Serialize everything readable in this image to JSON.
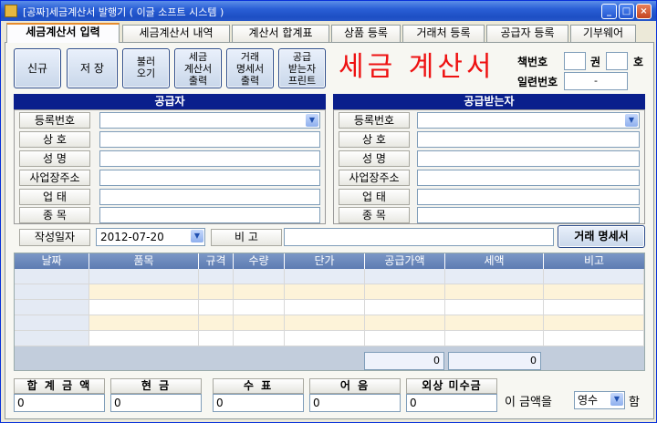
{
  "window": {
    "title": "[공짜]세금계산서 발행기 ( 이글 소프트 시스템 )",
    "min": "_",
    "max": "□",
    "close": "×"
  },
  "tabs": [
    {
      "label": "세금계산서 입력"
    },
    {
      "label": "세금계산서 내역"
    },
    {
      "label": "계산서 합계표"
    },
    {
      "label": "상품 등록"
    },
    {
      "label": "거래처 등록"
    },
    {
      "label": "공급자 등록"
    },
    {
      "label": "기부웨어"
    }
  ],
  "toolbar": {
    "new": "신규",
    "save": "저 장",
    "load": [
      "불러",
      "오기"
    ],
    "print_invoice": [
      "세금",
      "계산서",
      "출력"
    ],
    "print_statement": [
      "거래",
      "명세서",
      "출력"
    ],
    "print_receiver": [
      "공급",
      "받는자",
      "프린트"
    ]
  },
  "doc_title": "세금 계산서",
  "book": {
    "label": "책번호",
    "vol": "권",
    "no": "호",
    "serial_label": "일련번호",
    "serial_value": "-"
  },
  "supplier": {
    "header": "공급자",
    "fields": [
      "등록번호",
      "상   호",
      "성 명",
      "사업장주소",
      "업   태",
      "종 목"
    ]
  },
  "receiver": {
    "header": "공급받는자",
    "fields": [
      "등록번호",
      "상   호",
      "성 명",
      "사업장주소",
      "업   태",
      "종 목"
    ]
  },
  "date_row": {
    "label": "작성일자",
    "value": "2012-07-20",
    "note_label": "비   고",
    "statement_button": "거래 명세서"
  },
  "grid": {
    "headers": [
      "날짜",
      "품목",
      "규격",
      "수량",
      "단가",
      "공급가액",
      "세액",
      "비고"
    ],
    "rows": 5,
    "total_supply": "0",
    "total_tax": "0"
  },
  "summary": {
    "labels": [
      "합 계 금 액",
      "현    금",
      "수    표",
      "어    음",
      "외상 미수금"
    ],
    "values": [
      "0",
      "0",
      "0",
      "0",
      "0"
    ],
    "suffix_pre": "이 금액을",
    "mode": "영수",
    "suffix_post": "함"
  }
}
